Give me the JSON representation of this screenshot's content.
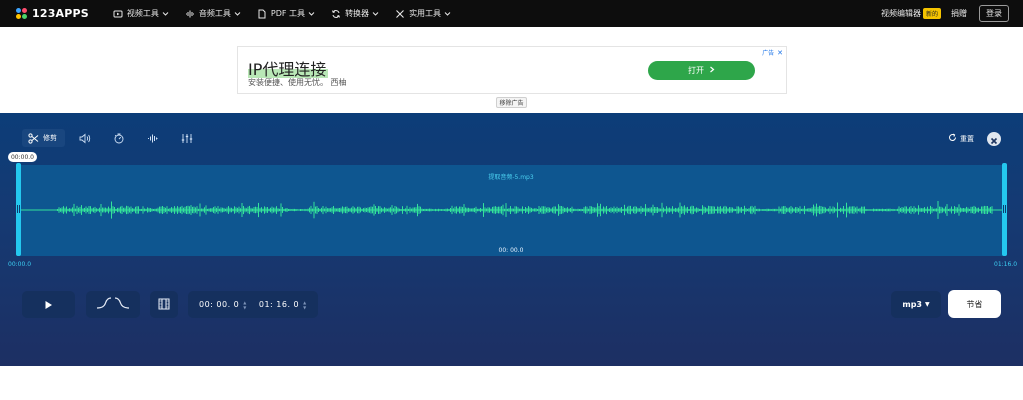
{
  "header": {
    "logo_text": "123APPS",
    "nav": [
      {
        "label": "视频工具",
        "icon": "video-icon"
      },
      {
        "label": "音频工具",
        "icon": "audio-icon"
      },
      {
        "label": "PDF 工具",
        "icon": "pdf-icon"
      },
      {
        "label": "转换器",
        "icon": "converter-icon"
      },
      {
        "label": "实用工具",
        "icon": "utilities-icon"
      }
    ],
    "video_editor_label": "视频编辑器",
    "new_badge": "新的",
    "donate_label": "捐赠",
    "login_label": "登录"
  },
  "ad": {
    "title": "IP代理连接",
    "subtitle": "安装便捷、使用无忧。 西柚",
    "button_label": "打开",
    "ad_label": "广告",
    "remove_ad_label": "移除广告"
  },
  "editor": {
    "tools": [
      {
        "name": "cut",
        "label": "修剪",
        "icon": "scissors-icon",
        "active": true
      },
      {
        "name": "volume",
        "icon": "volume-icon"
      },
      {
        "name": "speed",
        "icon": "speed-icon"
      },
      {
        "name": "equalizer",
        "icon": "equalizer-icon"
      },
      {
        "name": "mixer",
        "icon": "sliders-icon"
      }
    ],
    "reset_label": "重置",
    "playhead_time": "00:00.0",
    "filename": "提取音频-5.mp3",
    "wave_center_time": "00:  00.0",
    "range_start_label": "00:00.0",
    "range_end_label": "01:16.0",
    "start_time": "00:  00.  0",
    "end_time": "01:  16.  0",
    "format": "mp3",
    "save_label": "节省"
  },
  "colors": {
    "nav_bg": "#0d0d0d",
    "panel_top": "#0c3d78",
    "panel_bottom": "#1d2f63",
    "wave_bg": "#0e5690",
    "waveform": "#33e39a",
    "handle": "#24c8ef",
    "ad_button": "#2ea64a"
  }
}
